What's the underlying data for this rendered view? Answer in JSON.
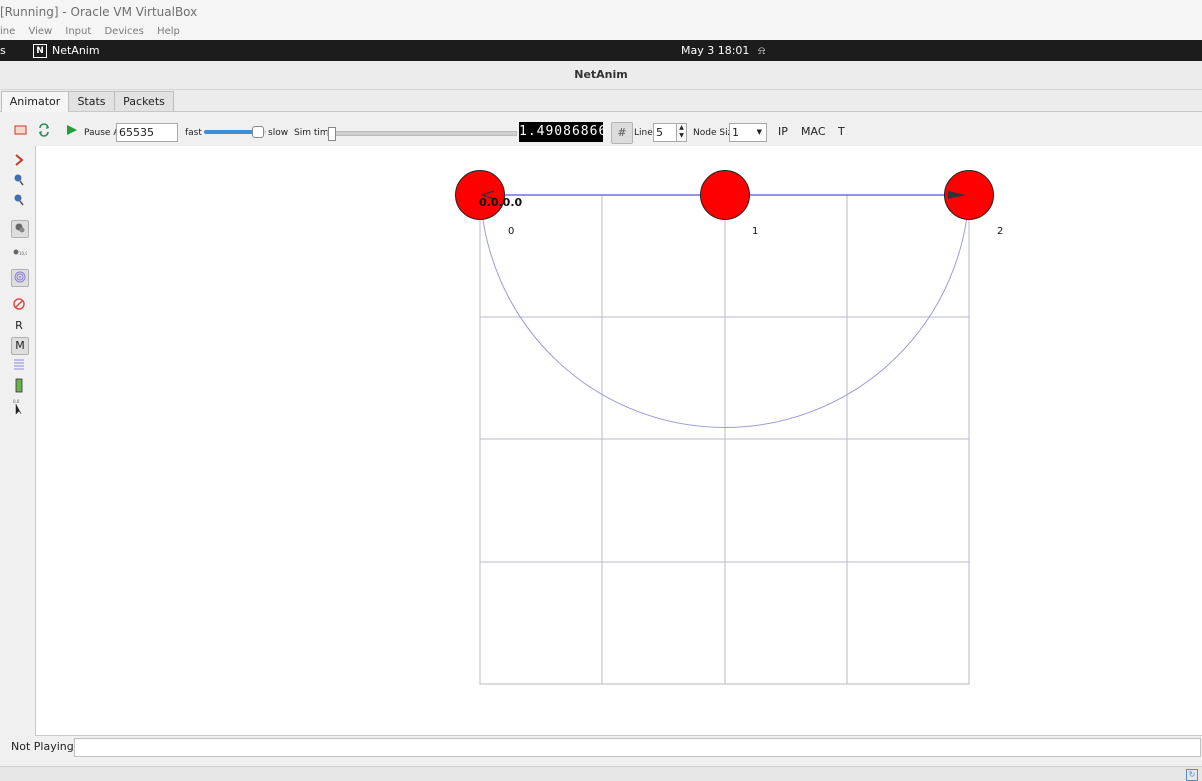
{
  "vbox": {
    "title": "[Running] - Oracle VM VirtualBox",
    "menu": [
      "ine",
      "View",
      "Input",
      "Devices",
      "Help"
    ]
  },
  "topbar": {
    "activities": "s",
    "app_name": "NetAnim",
    "app_logo_letter": "N",
    "clock": "May 3  18:01",
    "bell_icon": "bell-icon"
  },
  "window": {
    "title": "NetAnim"
  },
  "tabs": [
    {
      "label": "Animator",
      "active": true
    },
    {
      "label": "Stats",
      "active": false
    },
    {
      "label": "Packets",
      "active": false
    }
  ],
  "toolbar": {
    "pause_at_label": "Pause At",
    "pause_at_value": "65535",
    "fast_label": "fast",
    "slow_label": "slow",
    "speed_fraction": 0.85,
    "sim_time_label": "Sim time",
    "sim_time_fraction": 0.0,
    "time_display": "1.49086866",
    "lines_label": "Lines",
    "lines_value": "5",
    "node_size_label": "Node Size",
    "node_size_value": "1",
    "ip_label": "IP",
    "mac_label": "MAC",
    "t_label": "T"
  },
  "sidetools": {
    "r_label": "R",
    "m_label": "M"
  },
  "scene": {
    "nodes": [
      {
        "id": "0",
        "label": "0"
      },
      {
        "id": "1",
        "label": "1"
      },
      {
        "id": "2",
        "label": "2"
      }
    ],
    "packet_label": "0.0.0.0",
    "node_color": "#ff0000",
    "link_color": "#5555cc",
    "grid_color": "#b8b8c8",
    "range_color": "#9b9bd9"
  },
  "status": {
    "label": "Not Playing",
    "value": ""
  }
}
